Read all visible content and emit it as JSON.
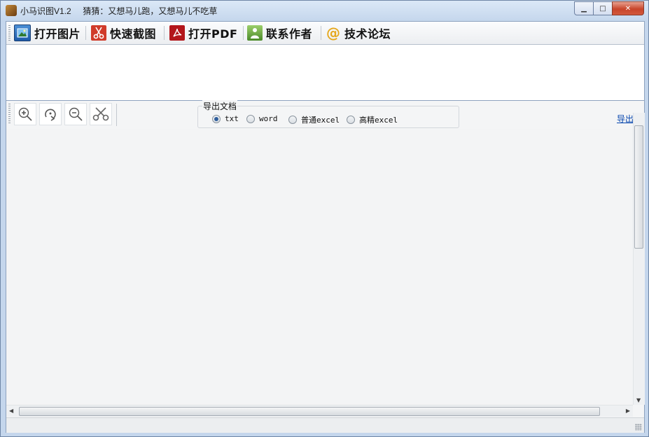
{
  "window": {
    "app_title": "小马识图V1.2",
    "tagline": "猜猜：又想马儿跑，又想马儿不吃草",
    "caption": {
      "minimize": "▭",
      "maximize": "□",
      "close": "✕"
    }
  },
  "toolbar": {
    "open_image": "打开图片",
    "quick_screenshot": "快速截图",
    "open_pdf": "打开PDF",
    "contact_author": "联系作者",
    "tech_forum": "技术论坛",
    "forum_icon_glyph": "@"
  },
  "export": {
    "group_title": "导出文档",
    "options": [
      "txt",
      "word",
      "普通excel",
      "高精excel"
    ],
    "selected": "txt",
    "link": "导出"
  },
  "colors": {
    "accent": "#2f5e9c",
    "link": "#0645ad",
    "pdf_red": "#c1272d",
    "scissors_red": "#d03b2a"
  }
}
